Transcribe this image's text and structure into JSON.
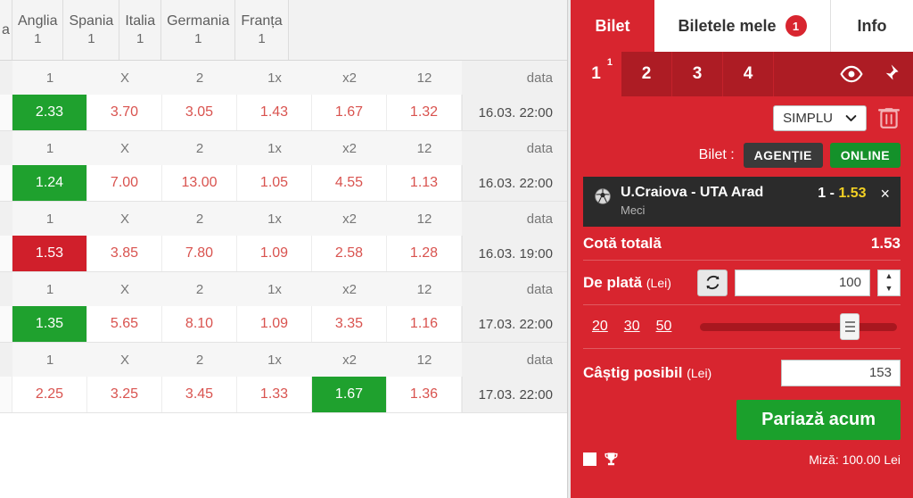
{
  "leagues": {
    "tabs": [
      {
        "name": "a",
        "count": "",
        "clipped": true
      },
      {
        "name": "Anglia",
        "count": "1"
      },
      {
        "name": "Spania",
        "count": "1"
      },
      {
        "name": "Italia",
        "count": "1"
      },
      {
        "name": "Germania",
        "count": "1"
      },
      {
        "name": "Franța",
        "count": "1"
      }
    ]
  },
  "odds_table": {
    "columns": [
      "1",
      "X",
      "2",
      "1x",
      "x2",
      "12"
    ],
    "date_column": "data",
    "rows": [
      {
        "odds": [
          "2.33",
          "3.70",
          "3.05",
          "1.43",
          "1.67",
          "1.32"
        ],
        "highlight_index": 0,
        "highlight_color": "green",
        "date": "16.03. 22:00"
      },
      {
        "odds": [
          "1.24",
          "7.00",
          "13.00",
          "1.05",
          "4.55",
          "1.13"
        ],
        "highlight_index": 0,
        "highlight_color": "green",
        "date": "16.03. 22:00"
      },
      {
        "odds": [
          "1.53",
          "3.85",
          "7.80",
          "1.09",
          "2.58",
          "1.28"
        ],
        "highlight_index": 0,
        "highlight_color": "red",
        "date": "16.03. 19:00"
      },
      {
        "odds": [
          "1.35",
          "5.65",
          "8.10",
          "1.09",
          "3.35",
          "1.16"
        ],
        "highlight_index": 0,
        "highlight_color": "green",
        "date": "17.03. 22:00"
      },
      {
        "odds": [
          "2.25",
          "3.25",
          "3.45",
          "1.33",
          "1.67",
          "1.36"
        ],
        "highlight_index": 4,
        "highlight_color": "green",
        "date": "17.03. 22:00"
      }
    ]
  },
  "betslip": {
    "tabs": {
      "bilet": "Bilet",
      "biletele_mele": "Biletele mele",
      "biletele_mele_badge": "1",
      "info": "Info"
    },
    "slip_numbers": [
      "1",
      "2",
      "3",
      "4"
    ],
    "active_slip": "1",
    "active_slip_superscript": "1",
    "icons": {
      "preview": "eye-icon",
      "pin": "pin-icon"
    },
    "type_select": {
      "value": "SIMPLU",
      "chevron": "chevron-down-icon"
    },
    "delete_icon": "trash-icon",
    "channel": {
      "label": "Bilet :",
      "agentie": "AGENȚIE",
      "online": "ONLINE"
    },
    "selection": {
      "sport_icon": "football-icon",
      "match": "U.Craiova - UTA Arad",
      "market": "Meci",
      "pick": "1 - ",
      "pick_odd": "1.53",
      "close": "×"
    },
    "total_odds": {
      "label": "Cotă totală",
      "value": "1.53"
    },
    "stake": {
      "label": "De plată",
      "unit": "(Lei)",
      "refresh_icon": "refresh-icon",
      "value": "100",
      "spin_up": "▲",
      "spin_down": "▼"
    },
    "quick_amounts": [
      "20",
      "30",
      "50"
    ],
    "possible_win": {
      "label": "Câștig posibil",
      "unit": "(Lei)",
      "value": "153"
    },
    "place_bet": "Pariază acum",
    "footer": {
      "trophy_icon": "trophy-icon",
      "miza": "Miză: 100.00 Lei"
    }
  },
  "colors": {
    "brand_red": "#d8252f",
    "selected_green": "#1fa12e",
    "selected_red": "#d01f2b",
    "odds_text": "#d9534f",
    "pick_yellow": "#f2d024"
  }
}
